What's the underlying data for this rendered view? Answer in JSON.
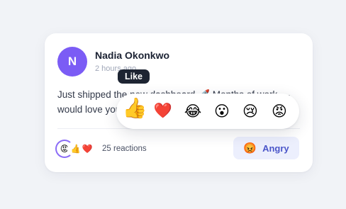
{
  "post": {
    "avatar_initial": "N",
    "author": "Nadia Okonkwo",
    "time": "2 hours ago",
    "text": "Just shipped the new dashboard 🚀 Months of work — would love your thoughts!"
  },
  "summary": {
    "emojis": [
      "😡",
      "👍",
      "❤️"
    ],
    "count_text": "25 reactions"
  },
  "action": {
    "emoji": "😡",
    "label": "Angry"
  },
  "picker": {
    "tooltip": "Like",
    "reactions": [
      {
        "name": "like",
        "emoji": "👍"
      },
      {
        "name": "love",
        "emoji": "❤️"
      },
      {
        "name": "haha",
        "emoji": "😂"
      },
      {
        "name": "wow",
        "emoji": "😮"
      },
      {
        "name": "sad",
        "emoji": "😢"
      },
      {
        "name": "angry",
        "emoji": "😡"
      }
    ]
  },
  "colors": {
    "avatar": "#7b5cf5",
    "accent": "#4b56c9",
    "button_bg": "#eceffd",
    "tooltip_bg": "#1d2432"
  }
}
